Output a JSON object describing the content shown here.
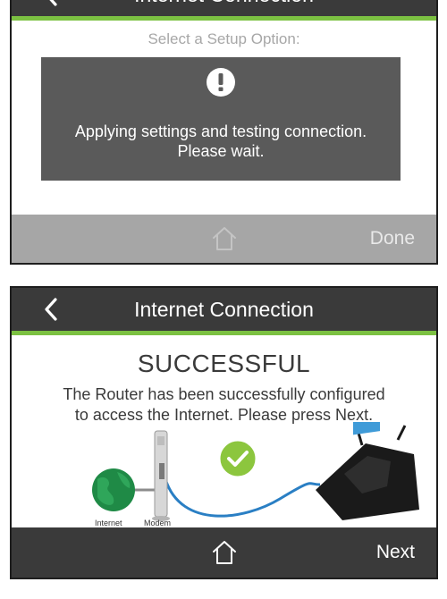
{
  "top_screen": {
    "header": {
      "title": "Internet Connection"
    },
    "setup_label": "Select a Setup Option:",
    "dialog": {
      "line1": "Applying settings and testing connection.",
      "line2": "Please wait."
    },
    "footer": {
      "action_label": "Done"
    }
  },
  "bottom_screen": {
    "header": {
      "title": "Internet Connection"
    },
    "status_title": "SUCCESSFUL",
    "message_line1": "The Router has been successfully configured",
    "message_line2": "to access the Internet. Please press Next.",
    "diagram": {
      "internet_label": "Internet",
      "modem_label": "Modem"
    },
    "footer": {
      "action_label": "Next"
    }
  },
  "colors": {
    "header_bg": "#3a3a3a",
    "accent_green": "#7cc142",
    "footer_disabled": "#a6a6a6",
    "dialog_bg": "#5a5a5a",
    "cable_blue": "#2a7fc4"
  },
  "icons": [
    "back-arrow-icon",
    "home-icon",
    "alert-icon",
    "check-icon",
    "globe-icon",
    "modem-icon",
    "router-icon"
  ]
}
